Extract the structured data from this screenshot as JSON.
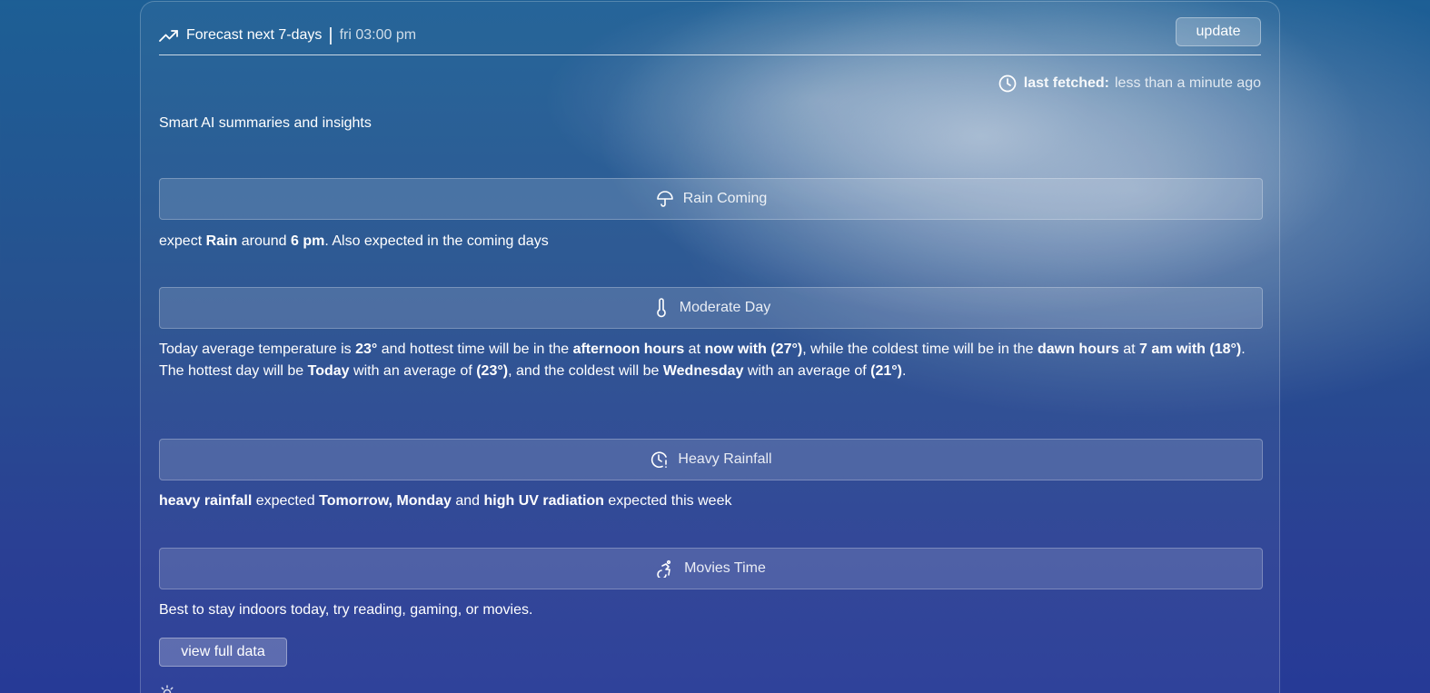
{
  "header": {
    "title": "Forecast next 7-days",
    "separator": "|",
    "time": "fri 03:00 pm",
    "update_label": "update",
    "trend_icon": "trending-up-icon"
  },
  "fetched": {
    "label": "last fetched:",
    "value": "less than a minute ago",
    "icon": "clock-icon"
  },
  "subtitle": "Smart AI summaries and insights",
  "cards": [
    {
      "title": "Rain Coming",
      "icon": "umbrella-icon",
      "text": [
        {
          "t": "expect ",
          "b": false
        },
        {
          "t": "Rain",
          "b": true
        },
        {
          "t": " around ",
          "b": false
        },
        {
          "t": "6 pm",
          "b": true
        },
        {
          "t": ". Also expected in the coming days",
          "b": false
        }
      ]
    },
    {
      "title": "Moderate Day",
      "icon": "thermometer-icon",
      "text": [
        {
          "t": "Today average temperature is ",
          "b": false
        },
        {
          "t": "23°",
          "b": true
        },
        {
          "t": " and hottest time will be in the ",
          "b": false
        },
        {
          "t": "afternoon hours",
          "b": true
        },
        {
          "t": " at ",
          "b": false
        },
        {
          "t": "now with (27°)",
          "b": true
        },
        {
          "t": ", while the coldest time will be in the ",
          "b": false
        },
        {
          "t": "dawn hours",
          "b": true
        },
        {
          "t": " at ",
          "b": false
        },
        {
          "t": "7 am with (18°)",
          "b": true
        },
        {
          "t": ".",
          "b": false
        }
      ],
      "text2": [
        {
          "t": "The hottest day will be ",
          "b": false
        },
        {
          "t": "Today",
          "b": true
        },
        {
          "t": " with an average of ",
          "b": false
        },
        {
          "t": "(23°)",
          "b": true
        },
        {
          "t": ", and the coldest will be ",
          "b": false
        },
        {
          "t": "Wednesday",
          "b": true
        },
        {
          "t": " with an average of ",
          "b": false
        },
        {
          "t": "(21°)",
          "b": true
        },
        {
          "t": ".",
          "b": false
        }
      ]
    },
    {
      "title": "Heavy Rainfall",
      "icon": "clock-alert-icon",
      "text": [
        {
          "t": "heavy rainfall",
          "b": true
        },
        {
          "t": " expected ",
          "b": false
        },
        {
          "t": "Tomorrow, Monday",
          "b": true
        },
        {
          "t": " and ",
          "b": false
        },
        {
          "t": "high UV radiation",
          "b": true
        },
        {
          "t": " expected this week",
          "b": false
        }
      ]
    },
    {
      "title": "Movies Time",
      "icon": "accessibility-icon",
      "text": [
        {
          "t": "Best to stay indoors today, try reading, gaming, or movies.",
          "b": false
        }
      ]
    }
  ],
  "view_full_data_label": "view full data",
  "colors": {
    "background_top": "#1d5f95",
    "background_bottom": "#263a96",
    "text": "#ffffff"
  }
}
